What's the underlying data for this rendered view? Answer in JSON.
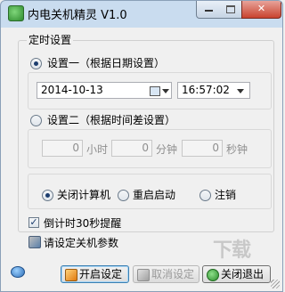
{
  "window": {
    "title": "内电关机精灵 V1.0"
  },
  "group": {
    "title": "定时设置"
  },
  "option1": {
    "label": "设置一（根据日期设置）",
    "checked": true,
    "date_value": "2014-10-13",
    "time_value": "16:57:02"
  },
  "option2": {
    "label": "设置二（根据时间差设置）",
    "checked": false,
    "hours_value": "0",
    "hours_unit": "小时",
    "minutes_value": "0",
    "minutes_unit": "分钟",
    "seconds_value": "0",
    "seconds_unit": "秒钟"
  },
  "actions": {
    "shutdown_label": "关闭计算机",
    "restart_label": "重启启动",
    "logoff_label": "注销",
    "selected": "shutdown"
  },
  "countdown": {
    "label": "倒计时30秒提醒",
    "checked": true
  },
  "hint": {
    "text": "请设定关机参数"
  },
  "buttons": {
    "start_label": "开启设定",
    "cancel_label": "取消设定",
    "exit_label": "关闭退出"
  },
  "watermark": {
    "text": "下载"
  },
  "colors": {
    "titlebar": "#c9dcef",
    "close_button": "#c9432f",
    "background": "#f0f0f0"
  }
}
